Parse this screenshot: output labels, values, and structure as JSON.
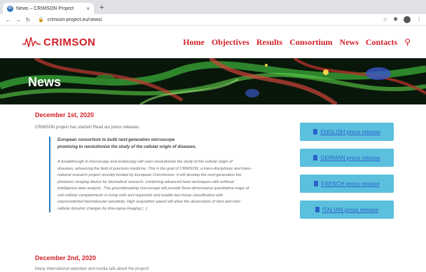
{
  "browser": {
    "tab_title": "News – CRIMSON Project",
    "tab_close": "×",
    "new_tab": "+",
    "url": "crimson-project.eu/news/",
    "icons": [
      "back-icon",
      "forward-icon",
      "reload-icon",
      "lock-icon",
      "star-icon",
      "extensions-icon",
      "profile-icon",
      "menu-icon"
    ]
  },
  "site": {
    "logo_text_left": "CRIMS",
    "logo_text_mid": "ON",
    "nav": {
      "home": "Home",
      "objectives": "Objectives",
      "results": "Results",
      "consortium": "Consortium",
      "news": "News",
      "contacts": "Contacts"
    },
    "hero_title": "News"
  },
  "posts": [
    {
      "date": "December 1st, 2020",
      "intro": "CRIMSON project has started! Read our press releases.",
      "quote_head_1": "European consortium to build next-generation microscope",
      "quote_head_2": "promising to revolutionize the study of the cellular origin of diseases.",
      "quote_lines": [
        "A breakthrough in microscopy and endoscopy will soon revolutionize the study of the cellular origin of",
        "diseases, advancing the field of precision medicine. This is the goal of CRIMSON, a trans-disciplinary and trans-",
        "national research project recently funded by European Commission. It will develop the next-generation bio-",
        "photonics imaging device for biomedical research, combining advanced laser techniques with artificial-",
        "intelligence data analysis. This groundbreaking microscope will provide three-dimensional quantitative maps of",
        "sub-cellular compartments in living cells and organoids and enable fast tissue classification with",
        "unprecedented biomolecular sensitivity. High acquisition speed will allow the observation of intra and inter-",
        "cellular dynamic changes by time-lapse imaging [...]"
      ],
      "press": [
        "ENGLISH press release",
        "GERMAN press release",
        "FRENCH press release",
        "ITALIAN press release"
      ]
    },
    {
      "date": "December 2nd, 2020",
      "intro": "Many international websites and media talk about the project!"
    }
  ],
  "colors": {
    "brand_red": "#d21d25",
    "press_button": "#5bc0de",
    "link_blue": "#2a63c9",
    "quote_border": "#2a7abf"
  }
}
